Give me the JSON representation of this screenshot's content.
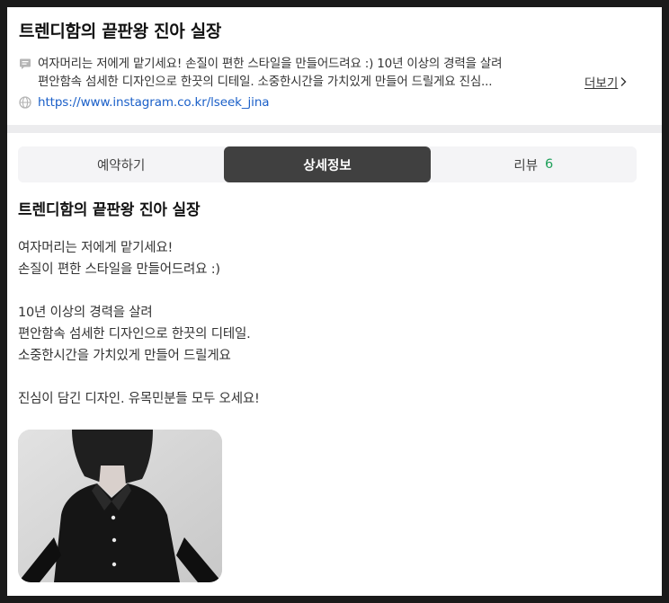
{
  "header": {
    "title": "트렌디함의 끝판왕 진아 실장",
    "description_line1": "여자머리는 저에게 맡기세요! 손질이 편한 스타일을 만들어드려요 :) 10년 이상의 경력을 살려",
    "description_line2": "편안함속 섬세한 디자인으로 한끗의 디테일. 소중한시간을 가치있게 만들어 드릴게요 진심...",
    "more_label": "더보기",
    "link": "https://www.instagram.co.kr/lseek_jina"
  },
  "tabs": [
    {
      "label": "예약하기"
    },
    {
      "label": "상세정보"
    },
    {
      "label": "리뷰",
      "count": "6"
    }
  ],
  "detail": {
    "title": "트렌디함의 끝판왕 진아 실장",
    "lines": [
      "여자머리는 저에게 맡기세요!",
      "손질이 편한 스타일을 만들어드려요 :)",
      "10년 이상의 경력을 살려",
      "편안함속 섬세한 디자인으로 한끗의 디테일.",
      "소중한시간을 가치있게 만들어 드릴게요",
      "진심이 담긴 디자인. 유목민분들 모두 오세요!"
    ]
  },
  "icons": {
    "description": "speech-bubble-icon",
    "link": "globe-icon",
    "more": "chevron-right-icon"
  },
  "colors": {
    "active_tab": "#404040",
    "link": "#1a5fc8",
    "review_count": "#1ea05a"
  }
}
